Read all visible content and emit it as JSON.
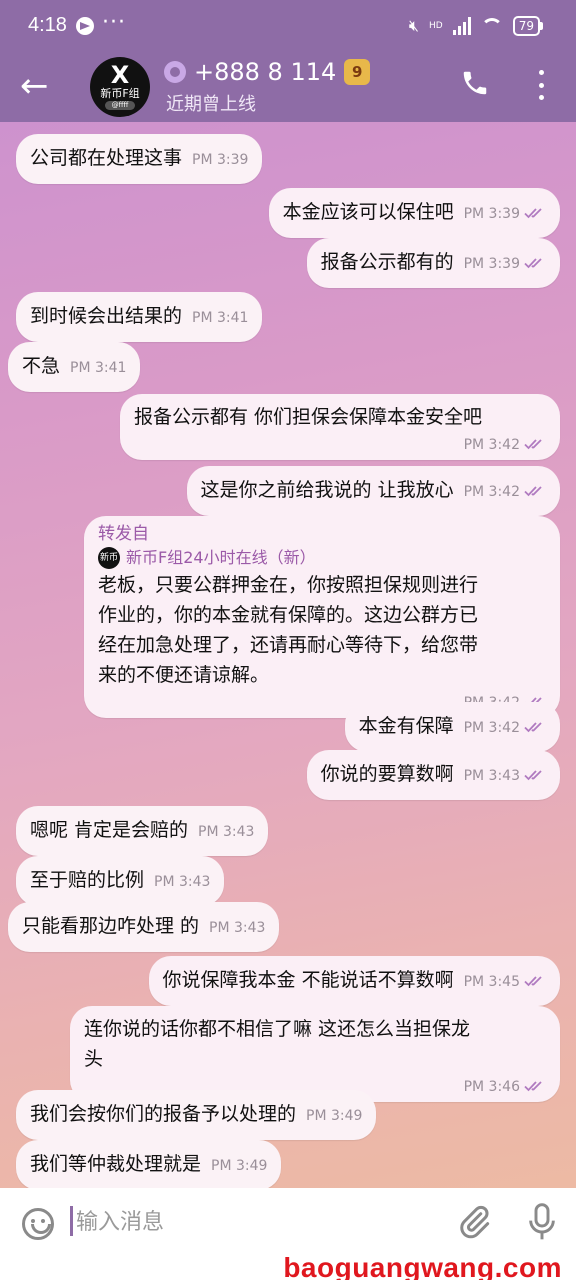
{
  "status_bar": {
    "time": "4:18",
    "dots": "···",
    "battery": "79",
    "network": "HD"
  },
  "header": {
    "contact_name": "+888 8 114",
    "status": "近期曾上线",
    "avatar": {
      "glyph": "X",
      "label": "新币F组",
      "tag": "@ffff"
    },
    "level_badge": "9"
  },
  "messages": [
    {
      "dir": "in",
      "text": "公司都在处理这事",
      "time": "PM 3:39"
    },
    {
      "dir": "out",
      "text": "本金应该可以保住吧",
      "time": "PM 3:39"
    },
    {
      "dir": "out",
      "text": "报备公示都有的",
      "time": "PM 3:39"
    },
    {
      "dir": "in",
      "text": "到时候会出结果的",
      "time": "PM 3:41"
    },
    {
      "dir": "in",
      "text": "不急",
      "time": "PM 3:41"
    },
    {
      "dir": "out",
      "text": "报备公示都有 你们担保会保障本金安全吧",
      "time": "PM 3:42"
    },
    {
      "dir": "out",
      "text": "这是你之前给我说的 让我放心",
      "time": "PM 3:42"
    },
    {
      "dir": "out",
      "forward": {
        "title": "转发自",
        "source": "新币F组24小时在线（新）",
        "source_avatar": "新币F组",
        "lines": [
          "老板，只要公群押金在，你按照担保规则进行",
          "作业的，你的本金就有保障的。这边公群方已",
          "经在加急处理了，还请再耐心等待下，给您带",
          "来的不便还请谅解。"
        ]
      },
      "time": "PM 3:42"
    },
    {
      "dir": "out",
      "text": "本金有保障",
      "time": "PM 3:42"
    },
    {
      "dir": "out",
      "text": "你说的要算数啊",
      "time": "PM 3:43"
    },
    {
      "dir": "in",
      "text": "嗯呢  肯定是会赔的",
      "time": "PM 3:43"
    },
    {
      "dir": "in",
      "text": "至于赔的比例",
      "time": "PM 3:43"
    },
    {
      "dir": "in",
      "text": "只能看那边咋处理 的",
      "time": "PM 3:43"
    },
    {
      "dir": "out",
      "text": "你说保障我本金 不能说话不算数啊",
      "time": "PM 3:45"
    },
    {
      "dir": "out",
      "lines": [
        "连你说的话你都不相信了嘛  这还怎么当担保龙",
        "头"
      ],
      "time": "PM 3:46"
    },
    {
      "dir": "in",
      "text": "我们会按你们的报备予以处理的",
      "time": "PM 3:49"
    },
    {
      "dir": "in",
      "text": "我们等仲裁处理就是",
      "time": "PM 3:49"
    }
  ],
  "input": {
    "placeholder": "输入消息"
  },
  "watermark": "baoguangwang.com",
  "colors": {
    "header": "#8e6ca6",
    "tick": "#b07ac0",
    "forward_accent": "#9b5aa8",
    "watermark": "#e0171e"
  },
  "icons": [
    "back-arrow-icon",
    "verified-gear-icon",
    "level-badge-icon",
    "phone-icon",
    "more-vert-icon",
    "emoji-icon",
    "attach-icon",
    "mic-icon",
    "double-check-icon"
  ]
}
